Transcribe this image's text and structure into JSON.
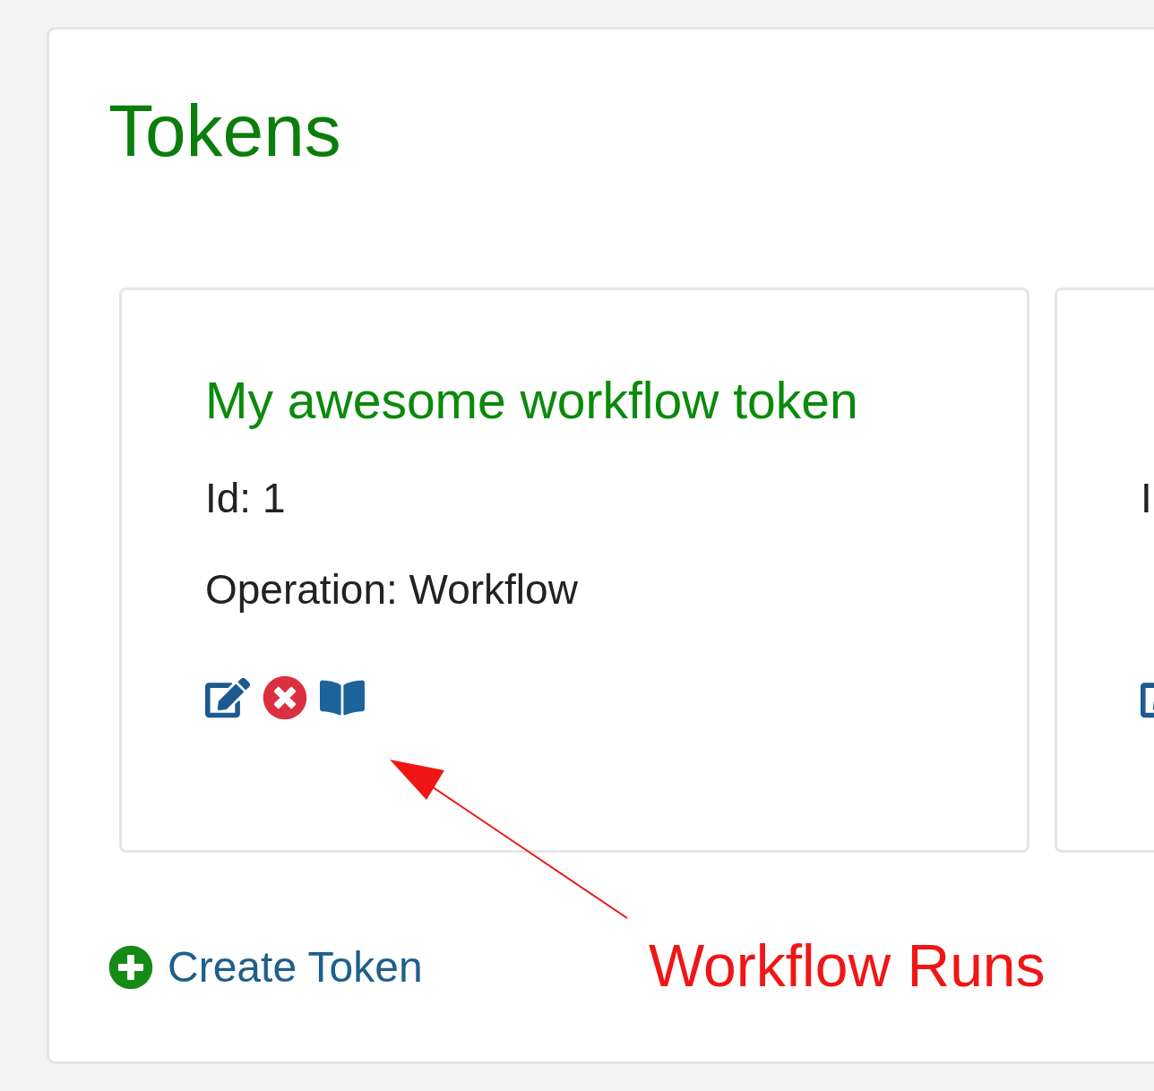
{
  "page": {
    "title": "Tokens"
  },
  "tokens": [
    {
      "title": "My awesome workflow token",
      "id": "Id: 1",
      "operation": "Operation: Workflow",
      "actions": [
        {
          "kind": "edit"
        },
        {
          "kind": "delete"
        },
        {
          "kind": "runs"
        }
      ]
    },
    {
      "id": "I",
      "actions": [
        {
          "kind": "edit"
        }
      ]
    }
  ],
  "create_button": {
    "label": "Create Token"
  },
  "annotation": {
    "text": "Workflow Runs"
  }
}
